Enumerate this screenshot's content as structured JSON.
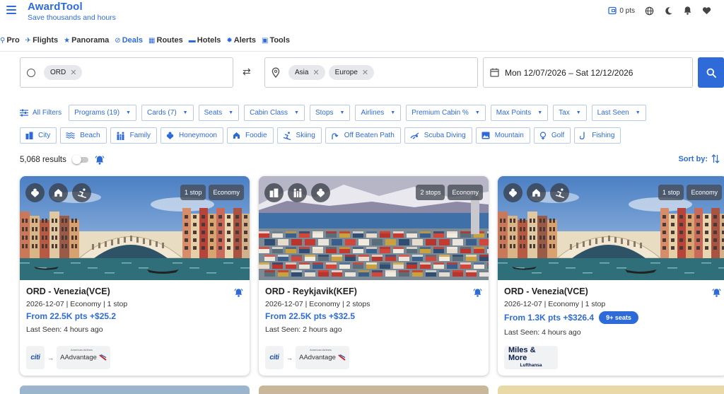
{
  "header": {
    "brand_title": "AwardTool",
    "brand_subtitle": "Save thousands and hours",
    "points": "0 pts"
  },
  "nav": [
    {
      "label": "Pro",
      "icon": "diamond-icon"
    },
    {
      "label": "Flights",
      "icon": "plane-icon"
    },
    {
      "label": "Panorama",
      "icon": "star-icon"
    },
    {
      "label": "Deals",
      "icon": "tag-icon",
      "active": true
    },
    {
      "label": "Routes",
      "icon": "calendar-icon"
    },
    {
      "label": "Hotels",
      "icon": "bed-icon"
    },
    {
      "label": "Alerts",
      "icon": "bell-icon"
    },
    {
      "label": "Tools",
      "icon": "toolbox-icon"
    }
  ],
  "search": {
    "origin_chips": [
      "ORD"
    ],
    "destination_chips": [
      "Asia",
      "Europe"
    ],
    "date_range": "Mon 12/07/2026 – Sat 12/12/2026"
  },
  "filters": {
    "all_label": "All Filters",
    "items": [
      "Programs (19)",
      "Cards (7)",
      "Seats",
      "Cabin Class",
      "Stops",
      "Airlines",
      "Premium Cabin %",
      "Max Points",
      "Tax",
      "Last Seen"
    ]
  },
  "tags": [
    {
      "label": "City",
      "icon": "city-icon"
    },
    {
      "label": "Beach",
      "icon": "waves-icon"
    },
    {
      "label": "Family",
      "icon": "family-icon"
    },
    {
      "label": "Honeymoon",
      "icon": "honeymoon-icon"
    },
    {
      "label": "Foodie",
      "icon": "foodie-icon"
    },
    {
      "label": "Skiing",
      "icon": "skiing-icon"
    },
    {
      "label": "Off Beaten Path",
      "icon": "path-icon"
    },
    {
      "label": "Scuba Diving",
      "icon": "scuba-icon"
    },
    {
      "label": "Mountain",
      "icon": "mountain-icon"
    },
    {
      "label": "Golf",
      "icon": "golf-icon"
    },
    {
      "label": "Fishing",
      "icon": "fishing-icon"
    }
  ],
  "results": {
    "count_label": "5,068 results",
    "sort_label": "Sort by:"
  },
  "cards": [
    {
      "route": "ORD - Venezia(VCE)",
      "meta": "2026-12-07 | Economy | 1 stop",
      "price": "From 22.5K pts +$25.2",
      "seats": "",
      "last_seen": "Last Seen: 4 hours ago",
      "badges": [
        "1 stop",
        "Economy"
      ],
      "category_icons": [
        "honeymoon-icon",
        "foodie-icon",
        "skiing-icon"
      ],
      "scene": "venice",
      "card_program": "citi",
      "airline_program": "AAdvantage"
    },
    {
      "route": "ORD - Reykjavik(KEF)",
      "meta": "2026-12-07 | Economy | 2 stops",
      "price": "From 22.5K pts +$32.5",
      "seats": "",
      "last_seen": "Last Seen: 2 hours ago",
      "badges": [
        "2 stops",
        "Economy"
      ],
      "category_icons": [
        "city-icon",
        "family-icon",
        "honeymoon-icon"
      ],
      "scene": "reykjavik",
      "card_program": "citi",
      "airline_program": "AAdvantage"
    },
    {
      "route": "ORD - Venezia(VCE)",
      "meta": "2026-12-07 | Economy | 1 stop",
      "price": "From 1.3K pts +$326.4",
      "seats": "9+ seats",
      "last_seen": "Last Seen: 4 hours ago",
      "badges": [
        "1 stop",
        "Economy"
      ],
      "category_icons": [
        "honeymoon-icon",
        "foodie-icon",
        "skiing-icon"
      ],
      "scene": "venice",
      "card_program": "",
      "airline_program": "Miles & More",
      "airline_sub": "Lufthansa"
    }
  ],
  "logo_fineprint": "American Airlines",
  "colors": {
    "accent": "#2f6bd8",
    "badge_bg": "#464b55",
    "chip_bg": "#e6e8eb"
  }
}
